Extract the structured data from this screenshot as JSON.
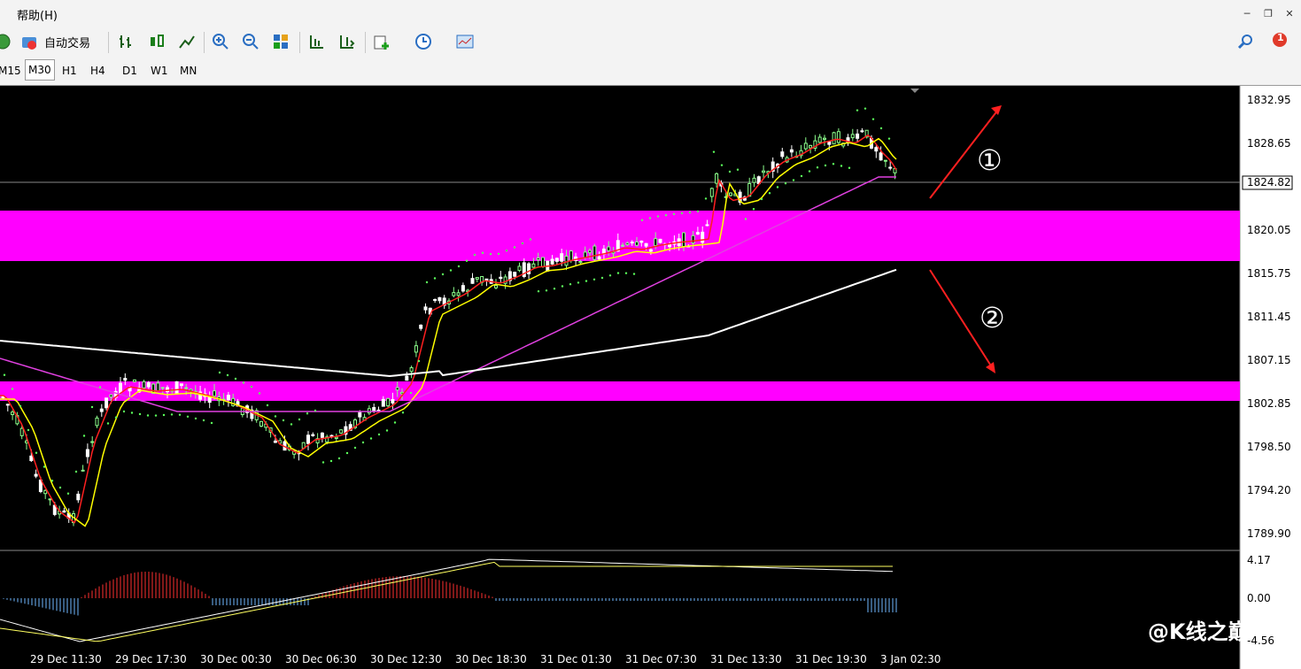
{
  "menubar": {
    "help_label": "帮助(H)"
  },
  "toolbar": {
    "auto_trade_label": "自动交易"
  },
  "timeframes": [
    "M15",
    "M30",
    "H1",
    "H4",
    "D1",
    "W1",
    "MN"
  ],
  "active_timeframe": "M30",
  "price_axis": [
    "1832.95",
    "1828.65",
    "1824.82",
    "1820.05",
    "1815.75",
    "1811.45",
    "1807.15",
    "1802.85",
    "1798.50",
    "1794.20",
    "1789.90"
  ],
  "current_price": "1824.82",
  "indicator_axis": [
    "4.17",
    "0.00",
    "-4.56"
  ],
  "time_axis": [
    "29 Dec 11:30",
    "29 Dec 17:30",
    "30 Dec 00:30",
    "30 Dec 06:30",
    "30 Dec 12:30",
    "30 Dec 18:30",
    "31 Dec 01:30",
    "31 Dec 07:30",
    "31 Dec 13:30",
    "31 Dec 19:30",
    "3 Jan 02:30"
  ],
  "annotations": {
    "up_marker": "①",
    "down_marker": "②"
  },
  "watermark": "@K线之巅",
  "notification_count": "1",
  "colors": {
    "zone": "#ff00ff",
    "bull": "#8cff8c",
    "bear": "#ffffff",
    "ma_fast": "#ff0000",
    "ma_slow": "#ffff00"
  }
}
